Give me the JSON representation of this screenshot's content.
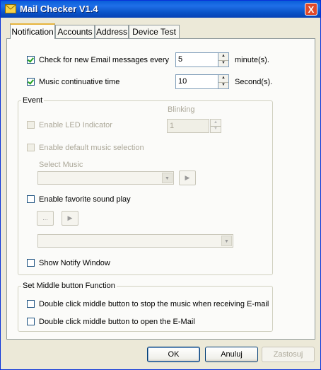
{
  "window": {
    "title": "Mail Checker V1.4",
    "close_label": "X"
  },
  "tabs": [
    {
      "label": "Notification",
      "active": true
    },
    {
      "label": "Accounts"
    },
    {
      "label": "Address"
    },
    {
      "label": "Device Test"
    }
  ],
  "check_email": {
    "label": "Check for new Email messages every",
    "checked": true,
    "value": "5",
    "unit": "minute(s)."
  },
  "music_time": {
    "label": "Music continuative time",
    "checked": true,
    "value": "10",
    "unit": "Second(s)."
  },
  "event": {
    "legend": "Event",
    "blinking_label": "Blinking",
    "blinking_value": "1",
    "led": {
      "label": "Enable LED Indicator",
      "checked": false,
      "disabled": true
    },
    "default_music": {
      "label": "Enable default music selection",
      "checked": false,
      "disabled": true
    },
    "select_music_label": "Select Music",
    "select_music_value": "",
    "favorite": {
      "label": "Enable favorite sound play",
      "checked": false
    },
    "browse_label": "...",
    "favorite_value": "",
    "notify": {
      "label": "Show Notify Window",
      "checked": false
    }
  },
  "middle": {
    "legend": "Set Middle button Function",
    "stop_music": {
      "label": "Double click middle button to stop  the music  when receiving E-mail",
      "checked": false
    },
    "open_email": {
      "label": "Double click middle button to open the E-Mail",
      "checked": false
    }
  },
  "buttons": {
    "ok": "OK",
    "cancel": "Anuluj",
    "apply": "Zastosuj"
  }
}
